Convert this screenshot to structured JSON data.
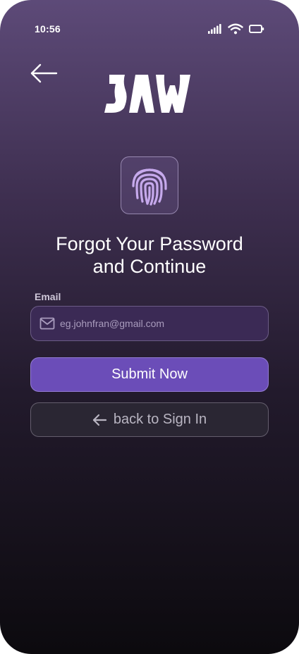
{
  "status_bar": {
    "time": "10:56"
  },
  "logo": {
    "text": "JAW"
  },
  "screen": {
    "title_line1": "Forgot Your Password",
    "title_line2": "and Continue"
  },
  "form": {
    "email_label": "Email",
    "email_value": "",
    "email_placeholder": "eg.johnfran@gmail.com",
    "submit_label": "Submit Now",
    "back_label": "back to Sign In"
  },
  "icons": {
    "back": "arrow-left-icon",
    "fingerprint": "fingerprint-icon",
    "mail": "mail-icon",
    "signal": "signal-icon",
    "wifi": "wifi-icon",
    "battery": "battery-icon"
  },
  "colors": {
    "primary_button": "#6b4db8",
    "input_background": "#3b2a55",
    "fingerprint_accent": "#c6a9ec",
    "gradient_top": "#5d4a78",
    "gradient_bottom": "#0c0a0e"
  }
}
